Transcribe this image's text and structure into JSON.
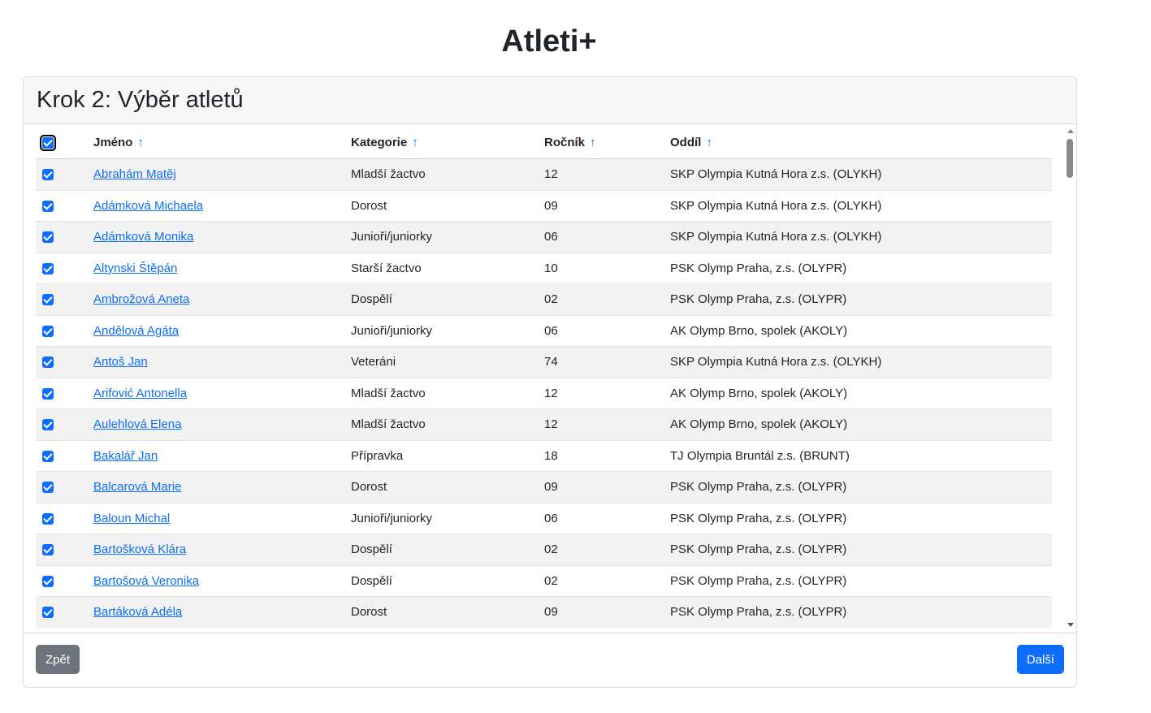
{
  "app": {
    "title": "Atleti+"
  },
  "card": {
    "title": "Krok 2: Výběr atletů"
  },
  "table": {
    "headers": {
      "name": "Jméno",
      "category": "Kategorie",
      "year": "Ročník",
      "club": "Oddíl"
    },
    "sort_icon": "arrow-up-icon",
    "rows": [
      {
        "name": "Abrahám Matěj",
        "category": "Mladší žactvo",
        "year": "12",
        "club": "SKP Olympia Kutná Hora z.s. (OLYKH)",
        "checked": true
      },
      {
        "name": "Adámková Michaela",
        "category": "Dorost",
        "year": "09",
        "club": "SKP Olympia Kutná Hora z.s. (OLYKH)",
        "checked": true
      },
      {
        "name": "Adámková Monika",
        "category": "Junioři/juniorky",
        "year": "06",
        "club": "SKP Olympia Kutná Hora z.s. (OLYKH)",
        "checked": true
      },
      {
        "name": "Altynski Štěpán",
        "category": "Starší žactvo",
        "year": "10",
        "club": "PSK Olymp Praha, z.s. (OLYPR)",
        "checked": true
      },
      {
        "name": "Ambrožová Aneta",
        "category": "Dospělí",
        "year": "02",
        "club": "PSK Olymp Praha, z.s. (OLYPR)",
        "checked": true
      },
      {
        "name": "Andělová Agáta",
        "category": "Junioři/juniorky",
        "year": "06",
        "club": "AK Olymp Brno, spolek (AKOLY)",
        "checked": true
      },
      {
        "name": "Antoš Jan",
        "category": "Veteráni",
        "year": "74",
        "club": "SKP Olympia Kutná Hora z.s. (OLYKH)",
        "checked": true
      },
      {
        "name": "Arifović Antonella",
        "category": "Mladší žactvo",
        "year": "12",
        "club": "AK Olymp Brno, spolek (AKOLY)",
        "checked": true
      },
      {
        "name": "Aulehlová Elena",
        "category": "Mladší žactvo",
        "year": "12",
        "club": "AK Olymp Brno, spolek (AKOLY)",
        "checked": true
      },
      {
        "name": "Bakalář Jan",
        "category": "Přípravka",
        "year": "18",
        "club": "TJ Olympia Bruntál z.s. (BRUNT)",
        "checked": true
      },
      {
        "name": "Balcarová Marie",
        "category": "Dorost",
        "year": "09",
        "club": "PSK Olymp Praha, z.s. (OLYPR)",
        "checked": true
      },
      {
        "name": "Baloun Michal",
        "category": "Junioři/juniorky",
        "year": "06",
        "club": "PSK Olymp Praha, z.s. (OLYPR)",
        "checked": true
      },
      {
        "name": "Bartošková Klára",
        "category": "Dospělí",
        "year": "02",
        "club": "PSK Olymp Praha, z.s. (OLYPR)",
        "checked": true
      },
      {
        "name": "Bartošová Veronika",
        "category": "Dospělí",
        "year": "02",
        "club": "PSK Olymp Praha, z.s. (OLYPR)",
        "checked": true
      },
      {
        "name": "Bartáková Adéla",
        "category": "Dorost",
        "year": "09",
        "club": "PSK Olymp Praha, z.s. (OLYPR)",
        "checked": true
      }
    ]
  },
  "footer": {
    "back_label": "Zpět",
    "next_label": "Další"
  },
  "colors": {
    "accent": "#0d6efd",
    "secondary": "#6c757d",
    "stripe": "#f2f2f2"
  }
}
